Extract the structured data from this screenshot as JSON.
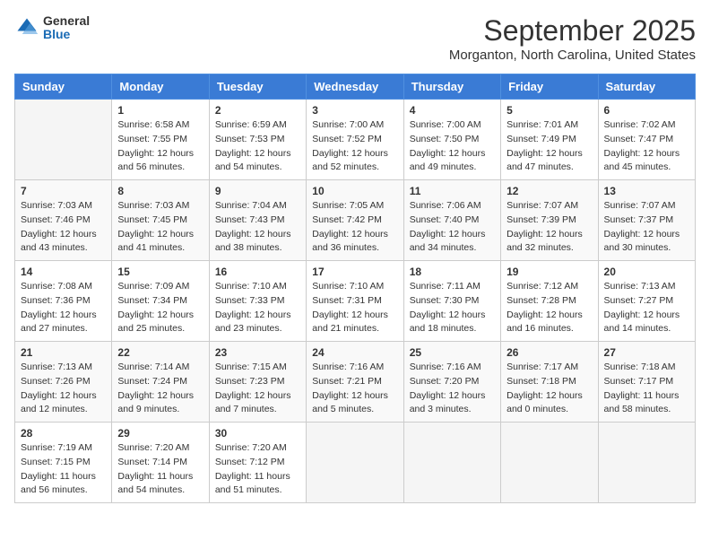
{
  "header": {
    "logo_general": "General",
    "logo_blue": "Blue",
    "month_title": "September 2025",
    "location": "Morganton, North Carolina, United States"
  },
  "days_of_week": [
    "Sunday",
    "Monday",
    "Tuesday",
    "Wednesday",
    "Thursday",
    "Friday",
    "Saturday"
  ],
  "weeks": [
    [
      {
        "day": "",
        "sunrise": "",
        "sunset": "",
        "daylight": ""
      },
      {
        "day": "1",
        "sunrise": "Sunrise: 6:58 AM",
        "sunset": "Sunset: 7:55 PM",
        "daylight": "Daylight: 12 hours and 56 minutes."
      },
      {
        "day": "2",
        "sunrise": "Sunrise: 6:59 AM",
        "sunset": "Sunset: 7:53 PM",
        "daylight": "Daylight: 12 hours and 54 minutes."
      },
      {
        "day": "3",
        "sunrise": "Sunrise: 7:00 AM",
        "sunset": "Sunset: 7:52 PM",
        "daylight": "Daylight: 12 hours and 52 minutes."
      },
      {
        "day": "4",
        "sunrise": "Sunrise: 7:00 AM",
        "sunset": "Sunset: 7:50 PM",
        "daylight": "Daylight: 12 hours and 49 minutes."
      },
      {
        "day": "5",
        "sunrise": "Sunrise: 7:01 AM",
        "sunset": "Sunset: 7:49 PM",
        "daylight": "Daylight: 12 hours and 47 minutes."
      },
      {
        "day": "6",
        "sunrise": "Sunrise: 7:02 AM",
        "sunset": "Sunset: 7:47 PM",
        "daylight": "Daylight: 12 hours and 45 minutes."
      }
    ],
    [
      {
        "day": "7",
        "sunrise": "Sunrise: 7:03 AM",
        "sunset": "Sunset: 7:46 PM",
        "daylight": "Daylight: 12 hours and 43 minutes."
      },
      {
        "day": "8",
        "sunrise": "Sunrise: 7:03 AM",
        "sunset": "Sunset: 7:45 PM",
        "daylight": "Daylight: 12 hours and 41 minutes."
      },
      {
        "day": "9",
        "sunrise": "Sunrise: 7:04 AM",
        "sunset": "Sunset: 7:43 PM",
        "daylight": "Daylight: 12 hours and 38 minutes."
      },
      {
        "day": "10",
        "sunrise": "Sunrise: 7:05 AM",
        "sunset": "Sunset: 7:42 PM",
        "daylight": "Daylight: 12 hours and 36 minutes."
      },
      {
        "day": "11",
        "sunrise": "Sunrise: 7:06 AM",
        "sunset": "Sunset: 7:40 PM",
        "daylight": "Daylight: 12 hours and 34 minutes."
      },
      {
        "day": "12",
        "sunrise": "Sunrise: 7:07 AM",
        "sunset": "Sunset: 7:39 PM",
        "daylight": "Daylight: 12 hours and 32 minutes."
      },
      {
        "day": "13",
        "sunrise": "Sunrise: 7:07 AM",
        "sunset": "Sunset: 7:37 PM",
        "daylight": "Daylight: 12 hours and 30 minutes."
      }
    ],
    [
      {
        "day": "14",
        "sunrise": "Sunrise: 7:08 AM",
        "sunset": "Sunset: 7:36 PM",
        "daylight": "Daylight: 12 hours and 27 minutes."
      },
      {
        "day": "15",
        "sunrise": "Sunrise: 7:09 AM",
        "sunset": "Sunset: 7:34 PM",
        "daylight": "Daylight: 12 hours and 25 minutes."
      },
      {
        "day": "16",
        "sunrise": "Sunrise: 7:10 AM",
        "sunset": "Sunset: 7:33 PM",
        "daylight": "Daylight: 12 hours and 23 minutes."
      },
      {
        "day": "17",
        "sunrise": "Sunrise: 7:10 AM",
        "sunset": "Sunset: 7:31 PM",
        "daylight": "Daylight: 12 hours and 21 minutes."
      },
      {
        "day": "18",
        "sunrise": "Sunrise: 7:11 AM",
        "sunset": "Sunset: 7:30 PM",
        "daylight": "Daylight: 12 hours and 18 minutes."
      },
      {
        "day": "19",
        "sunrise": "Sunrise: 7:12 AM",
        "sunset": "Sunset: 7:28 PM",
        "daylight": "Daylight: 12 hours and 16 minutes."
      },
      {
        "day": "20",
        "sunrise": "Sunrise: 7:13 AM",
        "sunset": "Sunset: 7:27 PM",
        "daylight": "Daylight: 12 hours and 14 minutes."
      }
    ],
    [
      {
        "day": "21",
        "sunrise": "Sunrise: 7:13 AM",
        "sunset": "Sunset: 7:26 PM",
        "daylight": "Daylight: 12 hours and 12 minutes."
      },
      {
        "day": "22",
        "sunrise": "Sunrise: 7:14 AM",
        "sunset": "Sunset: 7:24 PM",
        "daylight": "Daylight: 12 hours and 9 minutes."
      },
      {
        "day": "23",
        "sunrise": "Sunrise: 7:15 AM",
        "sunset": "Sunset: 7:23 PM",
        "daylight": "Daylight: 12 hours and 7 minutes."
      },
      {
        "day": "24",
        "sunrise": "Sunrise: 7:16 AM",
        "sunset": "Sunset: 7:21 PM",
        "daylight": "Daylight: 12 hours and 5 minutes."
      },
      {
        "day": "25",
        "sunrise": "Sunrise: 7:16 AM",
        "sunset": "Sunset: 7:20 PM",
        "daylight": "Daylight: 12 hours and 3 minutes."
      },
      {
        "day": "26",
        "sunrise": "Sunrise: 7:17 AM",
        "sunset": "Sunset: 7:18 PM",
        "daylight": "Daylight: 12 hours and 0 minutes."
      },
      {
        "day": "27",
        "sunrise": "Sunrise: 7:18 AM",
        "sunset": "Sunset: 7:17 PM",
        "daylight": "Daylight: 11 hours and 58 minutes."
      }
    ],
    [
      {
        "day": "28",
        "sunrise": "Sunrise: 7:19 AM",
        "sunset": "Sunset: 7:15 PM",
        "daylight": "Daylight: 11 hours and 56 minutes."
      },
      {
        "day": "29",
        "sunrise": "Sunrise: 7:20 AM",
        "sunset": "Sunset: 7:14 PM",
        "daylight": "Daylight: 11 hours and 54 minutes."
      },
      {
        "day": "30",
        "sunrise": "Sunrise: 7:20 AM",
        "sunset": "Sunset: 7:12 PM",
        "daylight": "Daylight: 11 hours and 51 minutes."
      },
      {
        "day": "",
        "sunrise": "",
        "sunset": "",
        "daylight": ""
      },
      {
        "day": "",
        "sunrise": "",
        "sunset": "",
        "daylight": ""
      },
      {
        "day": "",
        "sunrise": "",
        "sunset": "",
        "daylight": ""
      },
      {
        "day": "",
        "sunrise": "",
        "sunset": "",
        "daylight": ""
      }
    ]
  ]
}
